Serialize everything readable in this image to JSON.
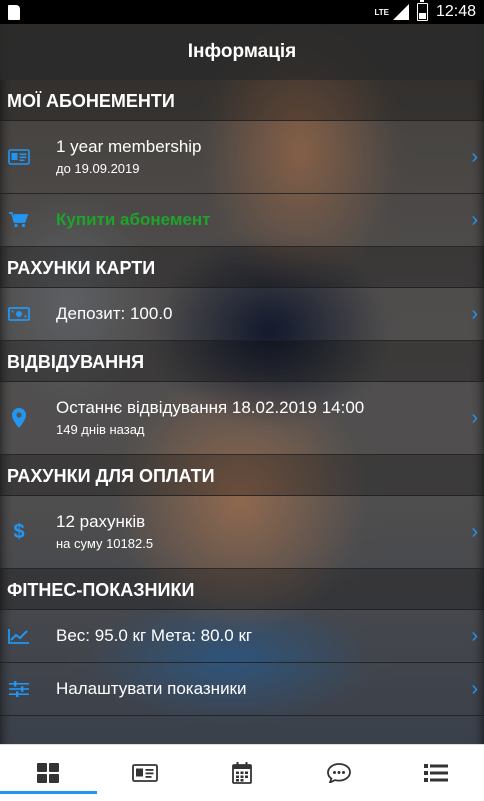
{
  "status_bar": {
    "network": "LTE",
    "time": "12:48"
  },
  "appbar": {
    "title": "Інформація"
  },
  "sections": {
    "memberships": {
      "title": "МОЇ АБОНЕМЕНТИ",
      "item": {
        "name": "1 year membership",
        "until": "до 19.09.2019",
        "icon": "id-card-icon"
      },
      "buy": {
        "label": "Купити абонемент",
        "icon": "cart-icon",
        "color": "#1fa32a"
      }
    },
    "card_accounts": {
      "title": "РАХУНКИ КАРТИ",
      "deposit": {
        "label": "Депозит: 100.0",
        "icon": "money-icon"
      }
    },
    "visits": {
      "title": "ВІДВІДУВАННЯ",
      "last": {
        "label": "Останнє відвідування 18.02.2019 14:00",
        "ago": "149 днів назад",
        "icon": "location-pin-icon"
      }
    },
    "invoices": {
      "title": "РАХУНКИ ДЛЯ ОПЛАТИ",
      "summary": {
        "count": "12 рахунків",
        "sum": "на суму 10182.5",
        "icon": "dollar-icon"
      }
    },
    "fitness": {
      "title": "ФІТНЕС-ПОКАЗНИКИ",
      "weight": {
        "label": "Вес: 95.0 кг Мета: 80.0 кг",
        "icon": "chart-line-icon"
      },
      "settings": {
        "label": "Налаштувати показники",
        "icon": "sliders-icon"
      }
    }
  },
  "bottom_nav": {
    "active_index": 0,
    "items": [
      "dashboard-icon",
      "id-card-icon",
      "calendar-icon",
      "chat-icon",
      "list-icon"
    ]
  },
  "colors": {
    "accent": "#2196f3",
    "buy_green": "#1fa32a"
  }
}
